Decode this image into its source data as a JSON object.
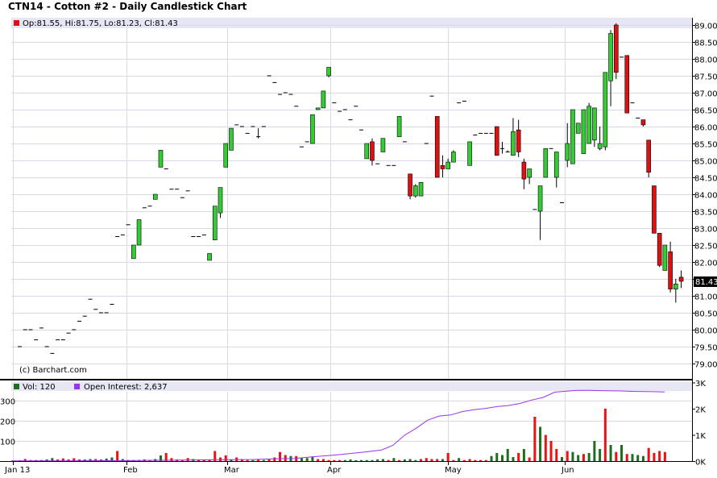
{
  "title": "CTN14 - Cotton #2 - Daily Candlestick Chart",
  "price_legend": "Op:81.55, Hi:81.75, Lo:81.23, Cl:81.43",
  "watermark": "(c) Barchart.com",
  "last_price_label": "81.43",
  "volume_legend": {
    "volume": "Vol: 120",
    "open_interest": "Open Interest: 2,637"
  },
  "colors": {
    "up": "#33cc33",
    "down": "#dd1111",
    "vol_up": "#1f6e1f",
    "vol_down": "#ee1111",
    "oi": "#9933ee",
    "header": "#e6e6f4",
    "grid": "#d8d8ec"
  },
  "chart_data": [
    {
      "type": "candlestick",
      "title": "CTN14 - Cotton #2 - Daily Candlestick Chart",
      "x_ticks": [
        "Jan 13",
        "Feb",
        "Mar",
        "Apr",
        "May",
        "Jun"
      ],
      "y_ticks": [
        "79.00",
        "79.50",
        "80.00",
        "80.50",
        "81.00",
        "81.50",
        "82.00",
        "82.50",
        "83.00",
        "83.50",
        "84.00",
        "84.50",
        "85.00",
        "85.50",
        "86.00",
        "86.50",
        "87.00",
        "87.50",
        "88.00",
        "88.50",
        "89.00"
      ],
      "ylim": [
        78.8,
        89.2
      ],
      "last": 81.43,
      "ohlc": [
        [
          79.5,
          79.5,
          79.5,
          79.5
        ],
        [
          80.0,
          80.0,
          80.0,
          80.0
        ],
        [
          80.0,
          80.0,
          80.0,
          80.0
        ],
        [
          79.7,
          79.7,
          79.7,
          79.7
        ],
        [
          80.05,
          80.05,
          80.05,
          80.05
        ],
        [
          79.5,
          79.5,
          79.5,
          79.5
        ],
        [
          79.3,
          79.3,
          79.3,
          79.3
        ],
        [
          79.7,
          79.7,
          79.7,
          79.7
        ],
        [
          79.7,
          79.7,
          79.7,
          79.7
        ],
        [
          79.9,
          79.9,
          79.9,
          79.9
        ],
        [
          80.0,
          80.0,
          80.0,
          80.0
        ],
        [
          80.25,
          80.25,
          80.25,
          80.25
        ],
        [
          80.4,
          80.4,
          80.4,
          80.4
        ],
        [
          80.9,
          80.9,
          80.9,
          80.9
        ],
        [
          80.6,
          80.6,
          80.6,
          80.6
        ],
        [
          80.5,
          80.5,
          80.5,
          80.5
        ],
        [
          80.5,
          80.5,
          80.5,
          80.5
        ],
        [
          80.75,
          80.75,
          80.75,
          80.75
        ],
        [
          82.75,
          82.75,
          82.75,
          82.75
        ],
        [
          82.8,
          82.8,
          82.8,
          82.8
        ],
        [
          83.1,
          83.1,
          83.1,
          83.1
        ],
        [
          82.1,
          82.5,
          82.1,
          82.5
        ],
        [
          82.5,
          83.25,
          82.5,
          83.25
        ],
        [
          83.6,
          83.6,
          83.6,
          83.6
        ],
        [
          83.65,
          83.65,
          83.65,
          83.65
        ],
        [
          83.85,
          84.0,
          83.85,
          84.0
        ],
        [
          84.8,
          85.3,
          84.8,
          85.3
        ],
        [
          84.75,
          84.75,
          84.75,
          84.75
        ],
        [
          84.15,
          84.15,
          84.15,
          84.15
        ],
        [
          84.15,
          84.15,
          84.15,
          84.15
        ],
        [
          83.9,
          83.9,
          83.9,
          83.9
        ],
        [
          84.1,
          84.1,
          84.1,
          84.1
        ],
        [
          82.75,
          82.75,
          82.75,
          82.75
        ],
        [
          82.75,
          82.75,
          82.75,
          82.75
        ],
        [
          82.8,
          82.8,
          82.8,
          82.8
        ],
        [
          82.05,
          82.25,
          82.05,
          82.25
        ],
        [
          82.65,
          83.65,
          82.65,
          83.65
        ],
        [
          83.45,
          84.2,
          83.3,
          84.2
        ],
        [
          84.8,
          85.5,
          84.8,
          85.5
        ],
        [
          85.3,
          85.95,
          85.3,
          85.95
        ],
        [
          86.05,
          86.05,
          86.05,
          86.05
        ],
        [
          86.0,
          86.0,
          86.0,
          86.0
        ],
        [
          85.8,
          85.8,
          85.8,
          85.8
        ],
        [
          86.0,
          86.0,
          86.0,
          86.0
        ],
        [
          85.7,
          85.95,
          85.65,
          85.7
        ],
        [
          86.0,
          86.0,
          86.0,
          86.0
        ],
        [
          87.5,
          87.5,
          87.5,
          87.5
        ],
        [
          87.3,
          87.3,
          87.3,
          87.3
        ],
        [
          86.95,
          86.95,
          86.95,
          86.95
        ],
        [
          87.0,
          87.0,
          87.0,
          87.0
        ],
        [
          86.95,
          86.95,
          86.95,
          86.95
        ],
        [
          86.6,
          86.6,
          86.6,
          86.6
        ],
        [
          85.4,
          85.4,
          85.4,
          85.4
        ],
        [
          85.55,
          85.55,
          85.55,
          85.55
        ],
        [
          85.5,
          86.35,
          85.5,
          86.35
        ],
        [
          86.5,
          86.55,
          86.5,
          86.55
        ],
        [
          86.55,
          87.05,
          86.55,
          87.05
        ],
        [
          87.5,
          87.75,
          87.45,
          87.75
        ],
        [
          86.7,
          86.7,
          86.7,
          86.7
        ],
        [
          86.45,
          86.45,
          86.45,
          86.45
        ],
        [
          86.5,
          85.95,
          85.95,
          86.5
        ],
        [
          86.2,
          86.2,
          86.2,
          86.2
        ],
        [
          86.6,
          86.6,
          86.6,
          86.6
        ],
        [
          85.9,
          85.9,
          85.9,
          85.9
        ],
        [
          85.05,
          85.5,
          85.05,
          85.5
        ],
        [
          85.55,
          85.65,
          84.85,
          85.0
        ],
        [
          84.9,
          84.9,
          84.9,
          84.9
        ],
        [
          85.25,
          85.65,
          85.25,
          85.65
        ],
        [
          84.85,
          84.85,
          84.85,
          84.85
        ],
        [
          84.85,
          84.85,
          84.85,
          84.85
        ],
        [
          85.7,
          86.3,
          85.7,
          86.3
        ],
        [
          85.55,
          85.55,
          85.55,
          85.55
        ],
        [
          84.6,
          84.6,
          83.85,
          83.95
        ],
        [
          83.95,
          84.3,
          83.9,
          84.25
        ],
        [
          83.95,
          84.35,
          83.95,
          84.35
        ],
        [
          85.5,
          85.5,
          85.5,
          85.5
        ],
        [
          86.9,
          86.9,
          86.9,
          86.9
        ],
        [
          86.3,
          86.3,
          84.5,
          84.5
        ],
        [
          84.85,
          85.15,
          84.5,
          84.75
        ],
        [
          84.75,
          85.05,
          84.75,
          84.95
        ],
        [
          84.95,
          85.3,
          84.95,
          85.25
        ],
        [
          86.7,
          86.7,
          86.7,
          86.7
        ],
        [
          86.75,
          86.75,
          86.75,
          86.75
        ],
        [
          84.85,
          85.55,
          84.85,
          85.55
        ],
        [
          85.75,
          85.75,
          85.75,
          85.75
        ],
        [
          85.8,
          85.8,
          85.8,
          85.8
        ],
        [
          85.8,
          85.8,
          85.8,
          85.8
        ],
        [
          85.8,
          85.8,
          85.8,
          85.8
        ],
        [
          86.0,
          86.0,
          85.15,
          85.15
        ],
        [
          85.35,
          85.55,
          85.2,
          85.35
        ],
        [
          85.25,
          85.3,
          85.25,
          85.25
        ],
        [
          85.15,
          86.25,
          85.15,
          85.85
        ],
        [
          85.9,
          86.2,
          85.1,
          85.25
        ],
        [
          84.95,
          85.05,
          84.15,
          84.45
        ],
        [
          84.5,
          84.75,
          84.3,
          84.75
        ],
        [
          83.55,
          83.55,
          83.55,
          83.55
        ],
        [
          83.5,
          84.25,
          82.65,
          84.25
        ],
        [
          84.5,
          85.35,
          84.5,
          85.35
        ],
        [
          85.35,
          85.35,
          85.35,
          85.35
        ],
        [
          84.5,
          85.25,
          84.2,
          85.25
        ],
        [
          83.75,
          83.75,
          83.75,
          83.75
        ],
        [
          85.0,
          86.1,
          84.8,
          85.5
        ],
        [
          84.9,
          86.5,
          84.9,
          86.5
        ],
        [
          85.8,
          86.1,
          85.8,
          86.1
        ],
        [
          85.2,
          86.5,
          85.2,
          86.5
        ],
        [
          85.5,
          86.7,
          85.5,
          86.6
        ],
        [
          85.6,
          86.55,
          85.4,
          86.55
        ],
        [
          85.35,
          86.0,
          85.3,
          85.5
        ],
        [
          85.4,
          87.6,
          85.3,
          87.6
        ],
        [
          87.35,
          88.85,
          86.6,
          88.75
        ],
        [
          89.0,
          89.05,
          87.4,
          87.6
        ],
        [
          88.05,
          88.05,
          88.05,
          88.05
        ],
        [
          88.1,
          88.1,
          86.45,
          86.4
        ],
        [
          86.7,
          86.7,
          86.7,
          86.7
        ],
        [
          86.25,
          86.25,
          86.25,
          86.25
        ],
        [
          86.2,
          86.2,
          86.0,
          86.05
        ],
        [
          85.6,
          85.6,
          84.5,
          84.65
        ],
        [
          84.25,
          84.25,
          82.85,
          82.85
        ],
        [
          82.85,
          82.85,
          81.85,
          81.9
        ],
        [
          81.75,
          82.5,
          81.75,
          82.5
        ],
        [
          82.3,
          82.6,
          81.1,
          81.2
        ],
        [
          81.2,
          81.5,
          80.8,
          81.35
        ],
        [
          81.55,
          81.75,
          81.23,
          81.43
        ]
      ]
    },
    {
      "type": "bar",
      "title": "",
      "y_ticks_left": [
        "300",
        "200",
        "100"
      ],
      "y_ticks_right": [
        "3K",
        "2K",
        "1K",
        "0K"
      ],
      "volume": [
        [
          3,
          1
        ],
        [
          10,
          0
        ],
        [
          5,
          0
        ],
        [
          5,
          0
        ],
        [
          5,
          1
        ],
        [
          8,
          1
        ],
        [
          15,
          1
        ],
        [
          8,
          0
        ],
        [
          13,
          0
        ],
        [
          8,
          0
        ],
        [
          14,
          0
        ],
        [
          8,
          0
        ],
        [
          8,
          1
        ],
        [
          10,
          1
        ],
        [
          10,
          0
        ],
        [
          8,
          0
        ],
        [
          12,
          1
        ],
        [
          18,
          1
        ],
        [
          50,
          0
        ],
        [
          10,
          1
        ],
        [
          5,
          1
        ],
        [
          5,
          1
        ],
        [
          5,
          0
        ],
        [
          8,
          0
        ],
        [
          5,
          0
        ],
        [
          10,
          1
        ],
        [
          28,
          1
        ],
        [
          40,
          0
        ],
        [
          15,
          0
        ],
        [
          8,
          0
        ],
        [
          5,
          0
        ],
        [
          15,
          0
        ],
        [
          10,
          1
        ],
        [
          8,
          0
        ],
        [
          5,
          0
        ],
        [
          8,
          0
        ],
        [
          50,
          0
        ],
        [
          18,
          0
        ],
        [
          28,
          0
        ],
        [
          8,
          1
        ],
        [
          18,
          0
        ],
        [
          10,
          0
        ],
        [
          5,
          0
        ],
        [
          5,
          1
        ],
        [
          10,
          0
        ],
        [
          5,
          1
        ],
        [
          8,
          0
        ],
        [
          18,
          0
        ],
        [
          45,
          0
        ],
        [
          30,
          0
        ],
        [
          25,
          1
        ],
        [
          25,
          0
        ],
        [
          15,
          1
        ],
        [
          15,
          1
        ],
        [
          20,
          1
        ],
        [
          10,
          0
        ],
        [
          10,
          0
        ],
        [
          5,
          0
        ],
        [
          5,
          0
        ],
        [
          5,
          0
        ],
        [
          5,
          1
        ],
        [
          8,
          1
        ],
        [
          3,
          1
        ],
        [
          5,
          1
        ],
        [
          5,
          1
        ],
        [
          5,
          1
        ],
        [
          8,
          1
        ],
        [
          10,
          1
        ],
        [
          5,
          0
        ],
        [
          15,
          1
        ],
        [
          5,
          0
        ],
        [
          8,
          1
        ],
        [
          10,
          1
        ],
        [
          5,
          1
        ],
        [
          10,
          0
        ],
        [
          15,
          0
        ],
        [
          10,
          0
        ],
        [
          10,
          0
        ],
        [
          10,
          1
        ],
        [
          40,
          0
        ],
        [
          5,
          0
        ],
        [
          15,
          1
        ],
        [
          5,
          0
        ],
        [
          10,
          0
        ],
        [
          5,
          0
        ],
        [
          5,
          0
        ],
        [
          5,
          0
        ],
        [
          25,
          1
        ],
        [
          40,
          1
        ],
        [
          30,
          1
        ],
        [
          60,
          1
        ],
        [
          20,
          1
        ],
        [
          40,
          0
        ],
        [
          60,
          1
        ],
        [
          18,
          0
        ],
        [
          220,
          0
        ],
        [
          170,
          1
        ],
        [
          130,
          0
        ],
        [
          100,
          0
        ],
        [
          60,
          0
        ],
        [
          20,
          1
        ],
        [
          50,
          0
        ],
        [
          45,
          1
        ],
        [
          30,
          1
        ],
        [
          35,
          0
        ],
        [
          40,
          1
        ],
        [
          100,
          1
        ],
        [
          60,
          1
        ],
        [
          260,
          0
        ],
        [
          80,
          1
        ],
        [
          45,
          0
        ],
        [
          80,
          1
        ],
        [
          35,
          0
        ],
        [
          35,
          1
        ],
        [
          30,
          1
        ],
        [
          25,
          1
        ],
        [
          65,
          0
        ],
        [
          40,
          0
        ],
        [
          50,
          0
        ],
        [
          45,
          0
        ]
      ],
      "open_interest": [
        [
          0,
          10
        ],
        [
          10,
          10
        ],
        [
          100,
          10
        ],
        [
          200,
          20
        ],
        [
          250,
          30
        ],
        [
          300,
          40
        ],
        [
          350,
          50
        ],
        [
          420,
          60
        ],
        [
          460,
          90
        ],
        [
          490,
          100
        ],
        [
          520,
          160
        ],
        [
          560,
          230
        ],
        [
          600,
          320
        ],
        [
          640,
          420
        ],
        [
          660,
          600
        ],
        [
          680,
          980
        ],
        [
          700,
          1250
        ],
        [
          720,
          1560
        ],
        [
          740,
          1720
        ],
        [
          760,
          1760
        ],
        [
          780,
          1890
        ],
        [
          800,
          1960
        ],
        [
          820,
          2010
        ],
        [
          840,
          2080
        ],
        [
          860,
          2120
        ],
        [
          880,
          2200
        ],
        [
          900,
          2330
        ],
        [
          920,
          2430
        ],
        [
          940,
          2630
        ],
        [
          960,
          2670
        ],
        [
          980,
          2700
        ],
        [
          1000,
          2700
        ],
        [
          1020,
          2690
        ],
        [
          1050,
          2680
        ],
        [
          1080,
          2660
        ],
        [
          1110,
          2650
        ],
        [
          1130,
          2637
        ]
      ]
    }
  ]
}
